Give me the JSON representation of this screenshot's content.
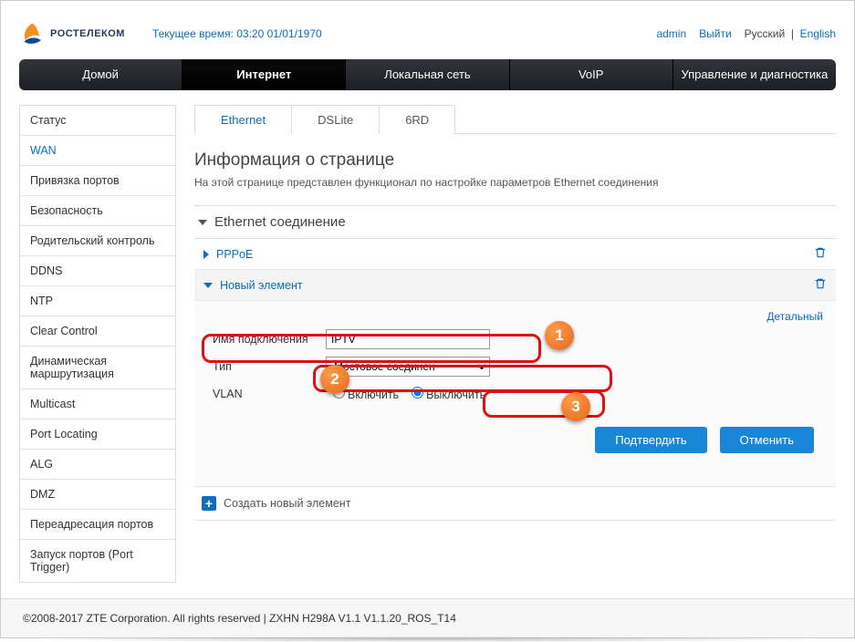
{
  "logo_text": "РОСТЕЛЕКОМ",
  "time_label": "Текущее время: 03:20 01/01/1970",
  "top_links": {
    "user": "admin",
    "logout": "Выйти",
    "lang_ru": "Русский",
    "lang_en": "English"
  },
  "nav": [
    "Домой",
    "Интернет",
    "Локальная сеть",
    "VoIP",
    "Управление и диагностика"
  ],
  "nav_active": 1,
  "sidebar": [
    "Статус",
    "WAN",
    "Привязка портов",
    "Безопасность",
    "Родительский контроль",
    "DDNS",
    "NTP",
    "Clear Control",
    "Динамическая маршрутизация",
    "Multicast",
    "Port Locating",
    "ALG",
    "DMZ",
    "Переадресация портов",
    "Запуск портов (Port Trigger)"
  ],
  "sidebar_active": 1,
  "tabs": [
    "Ethernet",
    "DSLite",
    "6RD"
  ],
  "tabs_active": 0,
  "page": {
    "title": "Информация о странице",
    "desc": "На этой странице представлен функционал по настройке параметров Ethernet соединения"
  },
  "section_title": "Ethernet соединение",
  "connections": {
    "pppoe": "PPPoE",
    "new": "Новый элемент"
  },
  "detail": "Детальный",
  "form": {
    "name_label": "Имя подключения",
    "name_value": "IPTV",
    "type_label": "Тип",
    "type_value": "Мостовое соединен",
    "vlan_label": "VLAN",
    "vlan_on": "Включить",
    "vlan_off": "Выключить"
  },
  "buttons": {
    "confirm": "Подтвердить",
    "cancel": "Отменить"
  },
  "create": "Создать новый элемент",
  "footer": "©2008-2017 ZTE Corporation. All rights reserved   |   ZXHN H298A V1.1 V1.1.20_ROS_T14",
  "callouts": {
    "1": "1",
    "2": "2",
    "3": "3"
  }
}
